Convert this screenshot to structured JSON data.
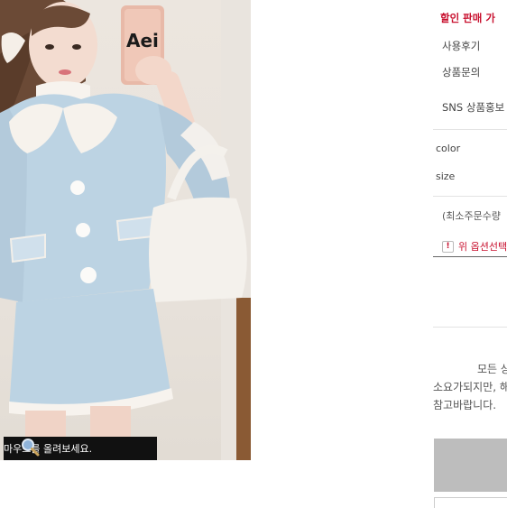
{
  "colors": {
    "accent_red": "#c8102e",
    "jacket_blue": "#bcd3e3",
    "hint_bg": "#111111"
  },
  "product_image": {
    "mirror_text": "Aei"
  },
  "zoom_hint": {
    "icon": "magnifier-icon",
    "text": "마우스를 올려보세요."
  },
  "info_menu": {
    "discount": "할인 판매 가",
    "review": "사용후기",
    "qna": "상품문의",
    "sns": "SNS 상품홍보"
  },
  "options": {
    "color_label": "color",
    "size_label": "size",
    "min_order": "(최소주문수량",
    "warning_icon": "!",
    "warning_text": "위 옵션선택"
  },
  "notice": {
    "line1": "모든 상",
    "line2": "소요가되지만, 해",
    "line3": "참고바랍니다."
  }
}
